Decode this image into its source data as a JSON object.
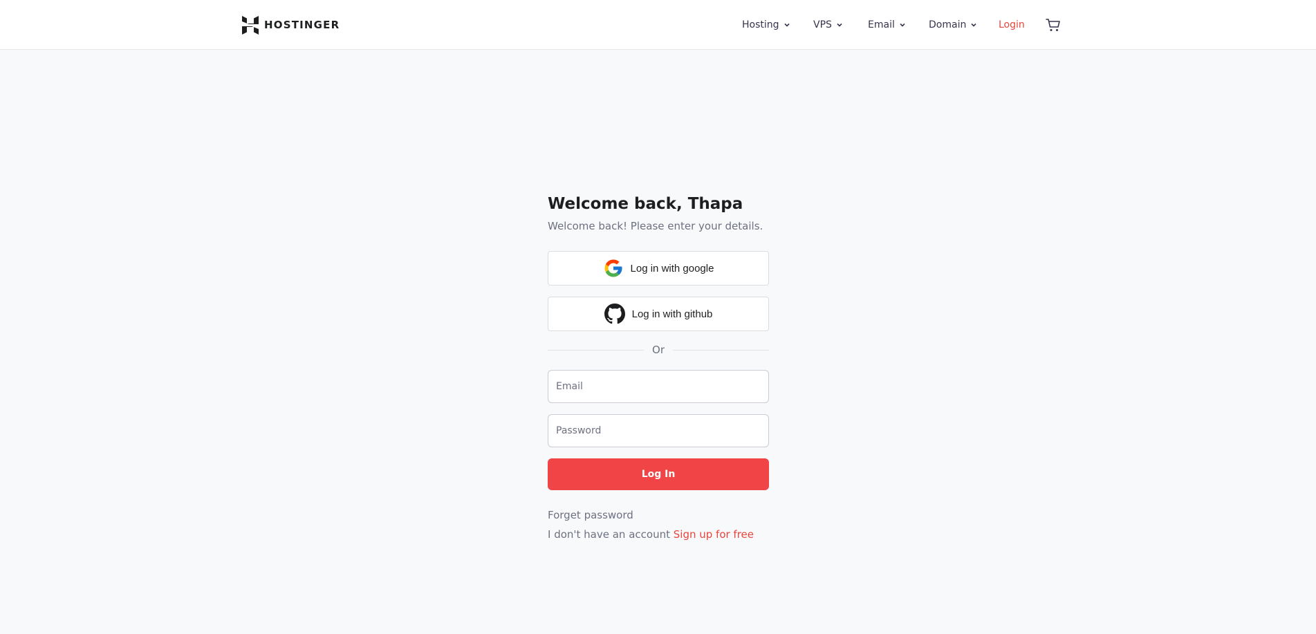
{
  "header": {
    "logo_text": "HOSTINGER",
    "nav": [
      {
        "label": "Hosting",
        "icon": "chevron-down-icon"
      },
      {
        "label": "VPS",
        "icon": "chevron-down-icon"
      },
      {
        "label": "Email",
        "icon": "chevron-down-icon"
      },
      {
        "label": "Domain",
        "icon": "chevron-down-icon"
      }
    ],
    "login_label": "Login",
    "cart_icon": "cart-icon"
  },
  "login": {
    "title": "Welcome back, Thapa",
    "subtitle": "Welcome back! Please enter your details.",
    "google_label": "Log in with google",
    "github_label": "Log in with github",
    "divider_text": "Or",
    "email_placeholder": "Email",
    "password_placeholder": "Password",
    "submit_label": "Log In",
    "forgot_label": "Forget password",
    "no_account_text": "I don't have an account",
    "signup_label": "Sign up for free"
  },
  "colors": {
    "accent": "#f04447",
    "link": "#e8453c",
    "background": "#f8f9fb",
    "text_muted": "#6d7081"
  }
}
